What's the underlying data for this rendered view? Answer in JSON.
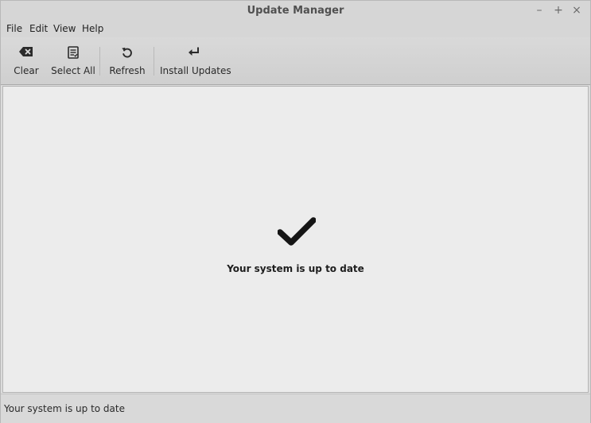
{
  "window": {
    "title": "Update Manager",
    "controls": {
      "minimize": "–",
      "maximize": "+",
      "close": "×"
    }
  },
  "menubar": {
    "items": [
      "File",
      "Edit",
      "View",
      "Help"
    ]
  },
  "toolbar": {
    "buttons": [
      {
        "label": "Clear",
        "icon": "backspace-icon"
      },
      {
        "label": "Select All",
        "icon": "checklist-icon"
      },
      {
        "label": "Refresh",
        "icon": "refresh-icon"
      },
      {
        "label": "Install Updates",
        "icon": "enter-arrow-icon"
      }
    ]
  },
  "main": {
    "status_icon": "checkmark-icon",
    "message": "Your system is up to date"
  },
  "statusbar": {
    "text": "Your system is up to date"
  },
  "colors": {
    "background": "#ececec",
    "toolbar": "#d4d4d4",
    "text": "#222222"
  }
}
